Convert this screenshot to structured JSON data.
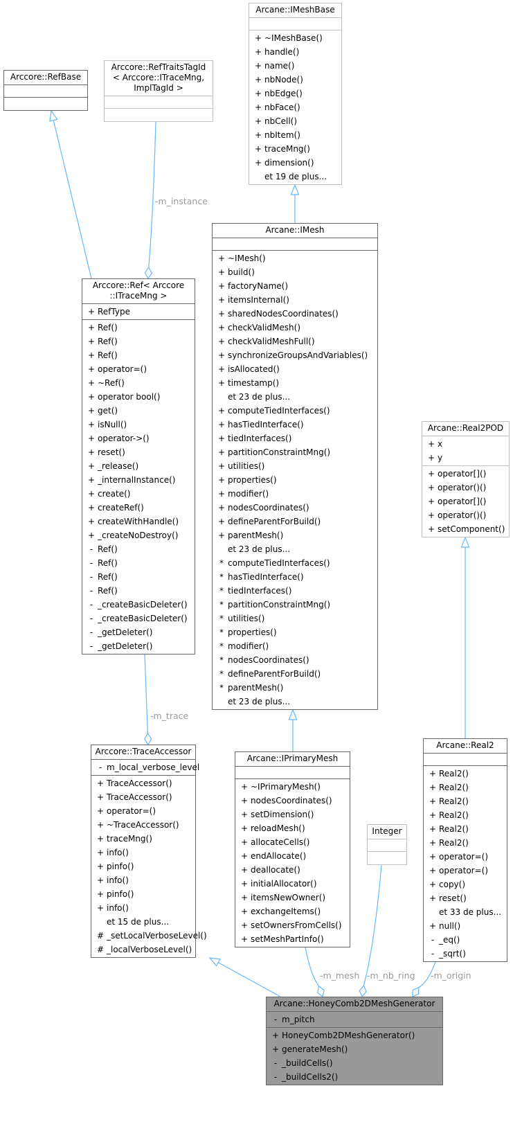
{
  "diagram": {
    "type": "uml-collaboration",
    "edge_color": "#63b8ff",
    "focus_color": "#999999",
    "classes": [
      {
        "id": "refbase",
        "title": "Arccore::RefBase",
        "external": false,
        "attributes": [],
        "methods": []
      },
      {
        "id": "reftraits",
        "title": "Arccore::RefTraitsTagId\n< Arccore::ITraceMng,\nImplTagId >",
        "external": true,
        "attributes": [],
        "methods": []
      },
      {
        "id": "imeshbase",
        "title": "Arcane::IMeshBase",
        "external": true,
        "attributes": [],
        "methods": [
          {
            "vis": "+",
            "name": "~IMeshBase()"
          },
          {
            "vis": "+",
            "name": "handle()"
          },
          {
            "vis": "+",
            "name": "name()"
          },
          {
            "vis": "+",
            "name": "nbNode()"
          },
          {
            "vis": "+",
            "name": "nbEdge()"
          },
          {
            "vis": "+",
            "name": "nbFace()"
          },
          {
            "vis": "+",
            "name": "nbCell()"
          },
          {
            "vis": "+",
            "name": "nbItem()"
          },
          {
            "vis": "+",
            "name": "traceMng()"
          },
          {
            "vis": "+",
            "name": "dimension()"
          },
          {
            "vis": "",
            "name": "et 19 de plus..."
          }
        ]
      },
      {
        "id": "ref",
        "title": "Arccore::Ref< Arccore\n::ITraceMng >",
        "external": false,
        "attributes": [
          {
            "vis": "+",
            "name": "RefType"
          }
        ],
        "methods": [
          {
            "vis": "+",
            "name": "Ref()"
          },
          {
            "vis": "+",
            "name": "Ref()"
          },
          {
            "vis": "+",
            "name": "Ref()"
          },
          {
            "vis": "+",
            "name": "operator=()"
          },
          {
            "vis": "+",
            "name": "~Ref()"
          },
          {
            "vis": "+",
            "name": "operator bool()"
          },
          {
            "vis": "+",
            "name": "get()"
          },
          {
            "vis": "+",
            "name": "isNull()"
          },
          {
            "vis": "+",
            "name": "operator->()"
          },
          {
            "vis": "+",
            "name": "reset()"
          },
          {
            "vis": "+",
            "name": "_release()"
          },
          {
            "vis": "+",
            "name": "_internalInstance()"
          },
          {
            "vis": "+",
            "name": "create()"
          },
          {
            "vis": "+",
            "name": "createRef()"
          },
          {
            "vis": "+",
            "name": "createWithHandle()"
          },
          {
            "vis": "+",
            "name": "_createNoDestroy()"
          },
          {
            "vis": "-",
            "name": "Ref()"
          },
          {
            "vis": "-",
            "name": "Ref()"
          },
          {
            "vis": "-",
            "name": "Ref()"
          },
          {
            "vis": "-",
            "name": "Ref()"
          },
          {
            "vis": "-",
            "name": "_createBasicDeleter()"
          },
          {
            "vis": "-",
            "name": "_createBasicDeleter()"
          },
          {
            "vis": "-",
            "name": "_getDeleter()"
          },
          {
            "vis": "-",
            "name": "_getDeleter()"
          }
        ]
      },
      {
        "id": "imesh",
        "title": "Arcane::IMesh",
        "external": false,
        "attributes": [],
        "methods": [
          {
            "vis": "+",
            "name": "~IMesh()"
          },
          {
            "vis": "+",
            "name": "build()"
          },
          {
            "vis": "+",
            "name": "factoryName()"
          },
          {
            "vis": "+",
            "name": "itemsInternal()"
          },
          {
            "vis": "+",
            "name": "sharedNodesCoordinates()"
          },
          {
            "vis": "+",
            "name": "checkValidMesh()"
          },
          {
            "vis": "+",
            "name": "checkValidMeshFull()"
          },
          {
            "vis": "+",
            "name": "synchronizeGroupsAndVariables()"
          },
          {
            "vis": "+",
            "name": "isAllocated()"
          },
          {
            "vis": "+",
            "name": "timestamp()"
          },
          {
            "vis": "",
            "name": "et 23 de plus..."
          },
          {
            "vis": "+",
            "name": "computeTiedInterfaces()"
          },
          {
            "vis": "+",
            "name": "hasTiedInterface()"
          },
          {
            "vis": "+",
            "name": "tiedInterfaces()"
          },
          {
            "vis": "+",
            "name": "partitionConstraintMng()"
          },
          {
            "vis": "+",
            "name": "utilities()"
          },
          {
            "vis": "+",
            "name": "properties()"
          },
          {
            "vis": "+",
            "name": "modifier()"
          },
          {
            "vis": "+",
            "name": "nodesCoordinates()"
          },
          {
            "vis": "+",
            "name": "defineParentForBuild()"
          },
          {
            "vis": "+",
            "name": "parentMesh()"
          },
          {
            "vis": "",
            "name": "et 23 de plus..."
          },
          {
            "vis": "*",
            "name": "computeTiedInterfaces()"
          },
          {
            "vis": "*",
            "name": "hasTiedInterface()"
          },
          {
            "vis": "*",
            "name": "tiedInterfaces()"
          },
          {
            "vis": "*",
            "name": "partitionConstraintMng()"
          },
          {
            "vis": "*",
            "name": "utilities()"
          },
          {
            "vis": "*",
            "name": "properties()"
          },
          {
            "vis": "*",
            "name": "modifier()"
          },
          {
            "vis": "*",
            "name": "nodesCoordinates()"
          },
          {
            "vis": "*",
            "name": "defineParentForBuild()"
          },
          {
            "vis": "*",
            "name": "parentMesh()"
          },
          {
            "vis": "",
            "name": "et 23 de plus..."
          }
        ]
      },
      {
        "id": "real2pod",
        "title": "Arcane::Real2POD",
        "external": true,
        "attributes": [
          {
            "vis": "+",
            "name": "x"
          },
          {
            "vis": "+",
            "name": "y"
          }
        ],
        "methods": [
          {
            "vis": "+",
            "name": "operator[]()"
          },
          {
            "vis": "+",
            "name": "operator()()"
          },
          {
            "vis": "+",
            "name": "operator[]()"
          },
          {
            "vis": "+",
            "name": "operator()()"
          },
          {
            "vis": "+",
            "name": "setComponent()"
          }
        ]
      },
      {
        "id": "traceaccessor",
        "title": "Arccore::TraceAccessor",
        "external": false,
        "attributes": [
          {
            "vis": "-",
            "name": "m_local_verbose_level"
          }
        ],
        "methods": [
          {
            "vis": "+",
            "name": "TraceAccessor()"
          },
          {
            "vis": "+",
            "name": "TraceAccessor()"
          },
          {
            "vis": "+",
            "name": "operator=()"
          },
          {
            "vis": "+",
            "name": "~TraceAccessor()"
          },
          {
            "vis": "+",
            "name": "traceMng()"
          },
          {
            "vis": "+",
            "name": "info()"
          },
          {
            "vis": "+",
            "name": "pinfo()"
          },
          {
            "vis": "+",
            "name": "info()"
          },
          {
            "vis": "+",
            "name": "pinfo()"
          },
          {
            "vis": "+",
            "name": "info()"
          },
          {
            "vis": "",
            "name": "et 15 de plus..."
          },
          {
            "vis": "#",
            "name": "_setLocalVerboseLevel()"
          },
          {
            "vis": "#",
            "name": "_localVerboseLevel()"
          }
        ]
      },
      {
        "id": "iprimarymesh",
        "title": "Arcane::IPrimaryMesh",
        "external": false,
        "attributes": [],
        "methods": [
          {
            "vis": "+",
            "name": "~IPrimaryMesh()"
          },
          {
            "vis": "+",
            "name": "nodesCoordinates()"
          },
          {
            "vis": "+",
            "name": "setDimension()"
          },
          {
            "vis": "+",
            "name": "reloadMesh()"
          },
          {
            "vis": "+",
            "name": "allocateCells()"
          },
          {
            "vis": "+",
            "name": "endAllocate()"
          },
          {
            "vis": "+",
            "name": "deallocate()"
          },
          {
            "vis": "+",
            "name": "initialAllocator()"
          },
          {
            "vis": "+",
            "name": "itemsNewOwner()"
          },
          {
            "vis": "+",
            "name": "exchangeItems()"
          },
          {
            "vis": "+",
            "name": "setOwnersFromCells()"
          },
          {
            "vis": "+",
            "name": "setMeshPartInfo()"
          }
        ]
      },
      {
        "id": "integer",
        "title": "Integer",
        "external": true,
        "attributes": [],
        "methods": []
      },
      {
        "id": "real2",
        "title": "Arcane::Real2",
        "external": false,
        "attributes": [],
        "methods": [
          {
            "vis": "+",
            "name": "Real2()"
          },
          {
            "vis": "+",
            "name": "Real2()"
          },
          {
            "vis": "+",
            "name": "Real2()"
          },
          {
            "vis": "+",
            "name": "Real2()"
          },
          {
            "vis": "+",
            "name": "Real2()"
          },
          {
            "vis": "+",
            "name": "Real2()"
          },
          {
            "vis": "+",
            "name": "operator=()"
          },
          {
            "vis": "+",
            "name": "operator=()"
          },
          {
            "vis": "+",
            "name": "copy()"
          },
          {
            "vis": "+",
            "name": "reset()"
          },
          {
            "vis": "",
            "name": "et 33 de plus..."
          },
          {
            "vis": "+",
            "name": "null()"
          },
          {
            "vis": "-",
            "name": "_eq()"
          },
          {
            "vis": "-",
            "name": "_sqrt()"
          }
        ]
      },
      {
        "id": "honeycomb",
        "title": "Arcane::HoneyComb2DMeshGenerator",
        "external": false,
        "focus": true,
        "attributes": [
          {
            "vis": "-",
            "name": "m_pitch"
          }
        ],
        "methods": [
          {
            "vis": "+",
            "name": "HoneyComb2DMeshGenerator()"
          },
          {
            "vis": "+",
            "name": "generateMesh()"
          },
          {
            "vis": "-",
            "name": "_buildCells()"
          },
          {
            "vis": "-",
            "name": "_buildCells2()"
          }
        ]
      }
    ],
    "edges": [
      {
        "from": "ref",
        "to": "refbase",
        "kind": "inheritance"
      },
      {
        "from": "reftraits",
        "to": "ref",
        "kind": "aggregation",
        "label": "-m_instance"
      },
      {
        "from": "imesh",
        "to": "imeshbase",
        "kind": "inheritance"
      },
      {
        "from": "ref",
        "to": "traceaccessor",
        "kind": "aggregation",
        "label": "-m_trace"
      },
      {
        "from": "iprimarymesh",
        "to": "imesh",
        "kind": "inheritance"
      },
      {
        "from": "real2",
        "to": "real2pod",
        "kind": "inheritance"
      },
      {
        "from": "honeycomb",
        "to": "traceaccessor",
        "kind": "inheritance"
      },
      {
        "from": "iprimarymesh",
        "to": "honeycomb",
        "kind": "aggregation",
        "label": "-m_mesh"
      },
      {
        "from": "integer",
        "to": "honeycomb",
        "kind": "aggregation",
        "label": "-m_nb_ring"
      },
      {
        "from": "real2",
        "to": "honeycomb",
        "kind": "aggregation",
        "label": "-m_origin"
      }
    ]
  }
}
